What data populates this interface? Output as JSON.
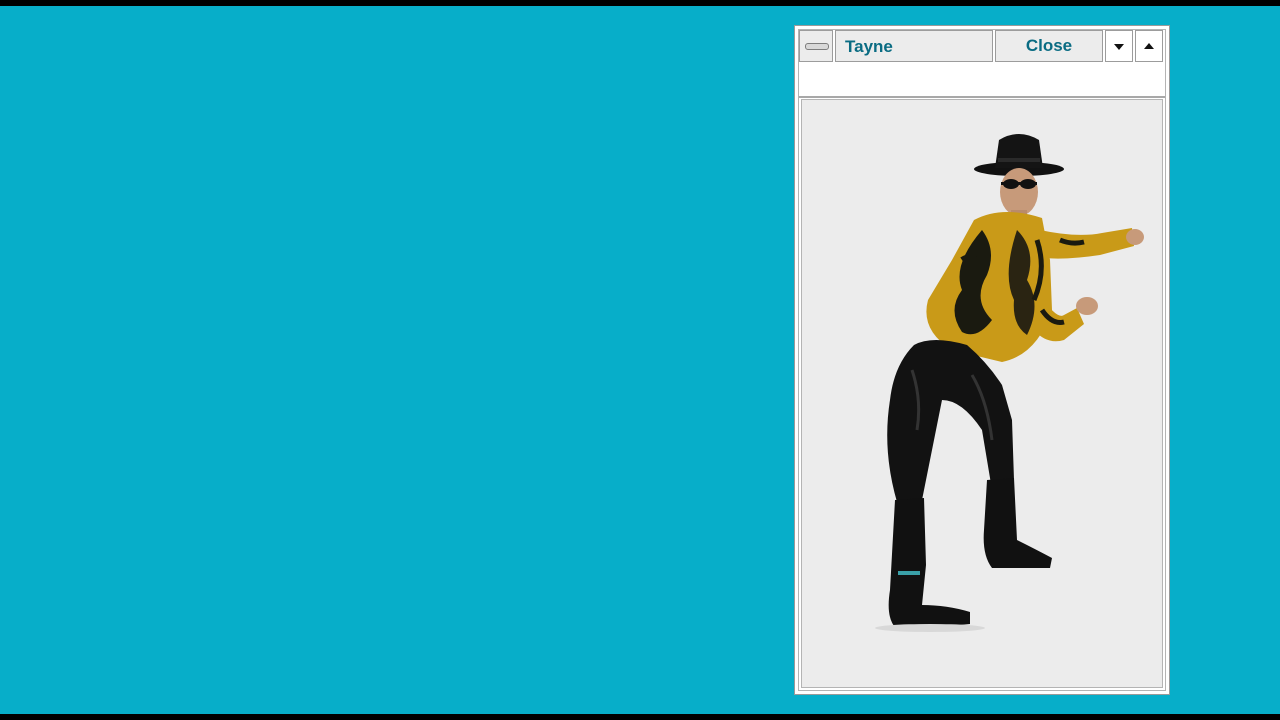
{
  "window": {
    "title": "Tayne",
    "close_label": "Close",
    "system_menu_icon": "system-menu-bar",
    "minimize_icon": "triangle-down",
    "maximize_icon": "triangle-up"
  },
  "content": {
    "image": "dancing-man-with-hat-and-sunglasses"
  },
  "colors": {
    "desktop": "#07aec9",
    "title_text": "#0a6c83",
    "button_face": "#ececec"
  }
}
